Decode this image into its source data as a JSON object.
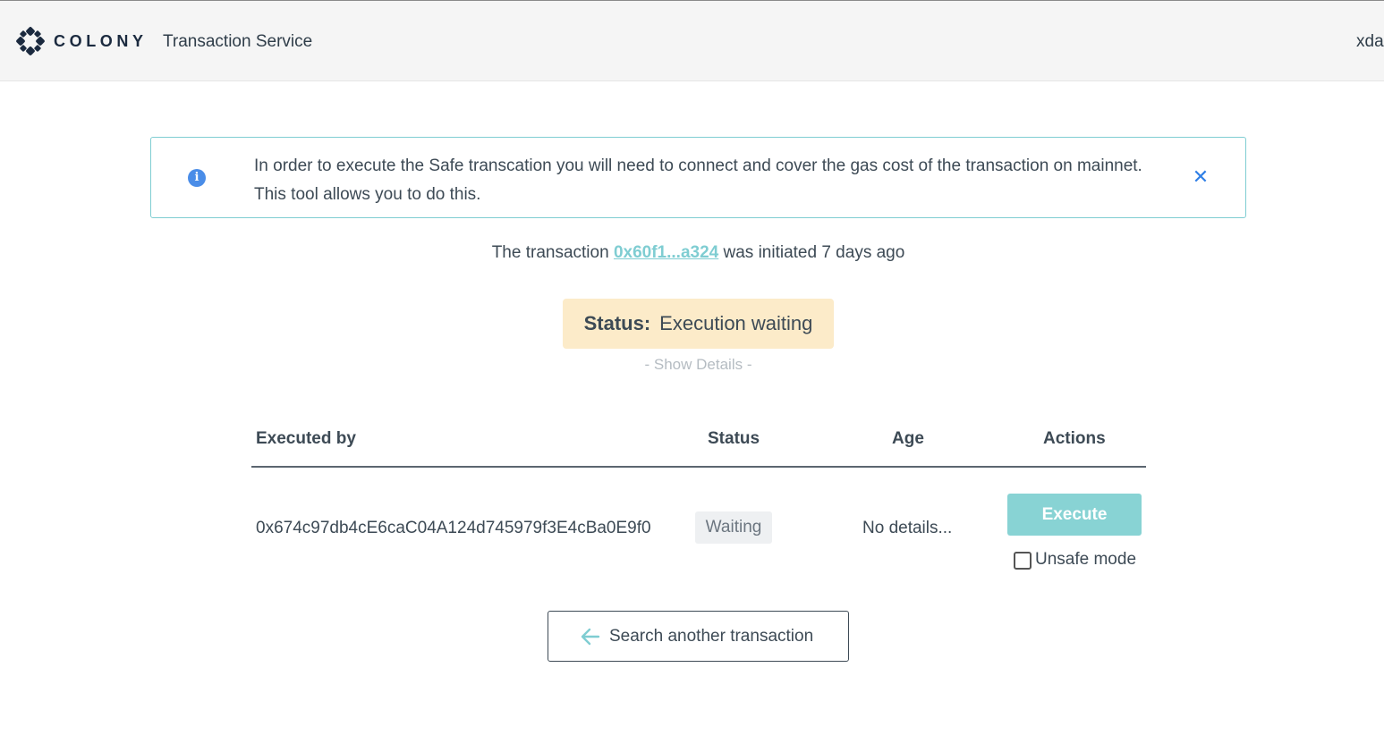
{
  "header": {
    "logo_text": "COLONY",
    "app_name": "Transaction Service",
    "network": "xdai"
  },
  "banner": {
    "icon": "info-icon",
    "text": "In order to execute the Safe transcation you will need to connect and cover the gas cost of the transaction on mainnet. This tool allows you to do this.",
    "close_icon": "close-icon"
  },
  "transaction": {
    "prefix": "The transaction",
    "hash_short": "0x60f1...a324",
    "suffix": "was initiated 7 days ago"
  },
  "status": {
    "label": "Status:",
    "value": "Execution waiting"
  },
  "show_details": "- Show Details -",
  "table": {
    "headers": [
      "Executed by",
      "Status",
      "Age",
      "Actions"
    ],
    "rows": [
      {
        "executed_by": "0x674c97db4cE6caC04A124d745979f3E4cBa0E9f0",
        "status": "Waiting",
        "age": "No details...",
        "action_label": "Execute",
        "unsafe_label": "Unsafe mode",
        "unsafe_checked": false
      }
    ]
  },
  "search_button": {
    "icon": "arrow-left-icon",
    "label": "Search another transaction"
  },
  "colors": {
    "accent": "#7fcdd2",
    "execute_bg": "#88d3d4",
    "status_bg": "#fcebc9",
    "info_blue": "#4a8de8",
    "close_blue": "#2f7fe6"
  }
}
